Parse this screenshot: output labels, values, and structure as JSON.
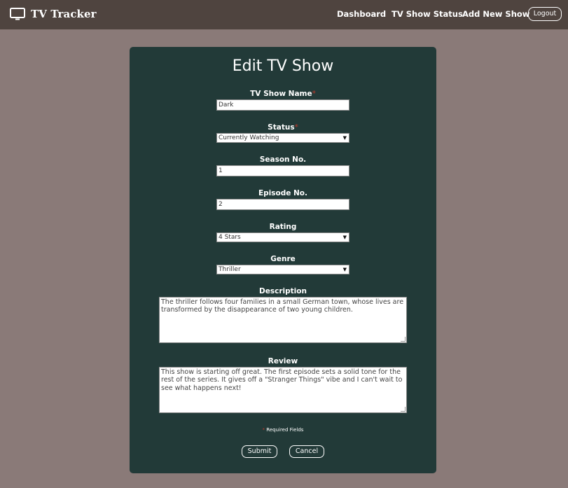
{
  "navbar": {
    "brand": "TV Tracker",
    "brand_icon": "tv-icon",
    "links": [
      "Dashboard",
      "TV Show Status",
      "Add New Show"
    ],
    "logout_label": "Logout"
  },
  "form": {
    "title": "Edit TV Show",
    "required_marker": "*",
    "fields": {
      "name": {
        "label": "TV Show Name",
        "value": "Dark"
      },
      "status": {
        "label": "Status",
        "value": "Currently Watching"
      },
      "season": {
        "label": "Season No.",
        "value": "1"
      },
      "episode": {
        "label": "Episode No.",
        "value": "2"
      },
      "rating": {
        "label": "Rating",
        "value": "4 Stars"
      },
      "genre": {
        "label": "Genre",
        "value": "Thriller"
      },
      "description": {
        "label": "Description",
        "value": "The thriller follows four families in a small German town, whose lives are transformed by the disappearance of two young children."
      },
      "review": {
        "label": "Review",
        "value": "This show is starting off great. The first episode sets a solid tone for the rest of the series. It gives off a \"Stranger Things\" vibe and I can't wait to see what happens next!"
      }
    },
    "required_note": "Required Fields",
    "submit_label": "Submit",
    "cancel_label": "Cancel"
  },
  "colors": {
    "page_bg": "#8a7a78",
    "navbar_bg": "#4f443f",
    "card_bg": "#223a38",
    "required_star": "#c0392b"
  }
}
